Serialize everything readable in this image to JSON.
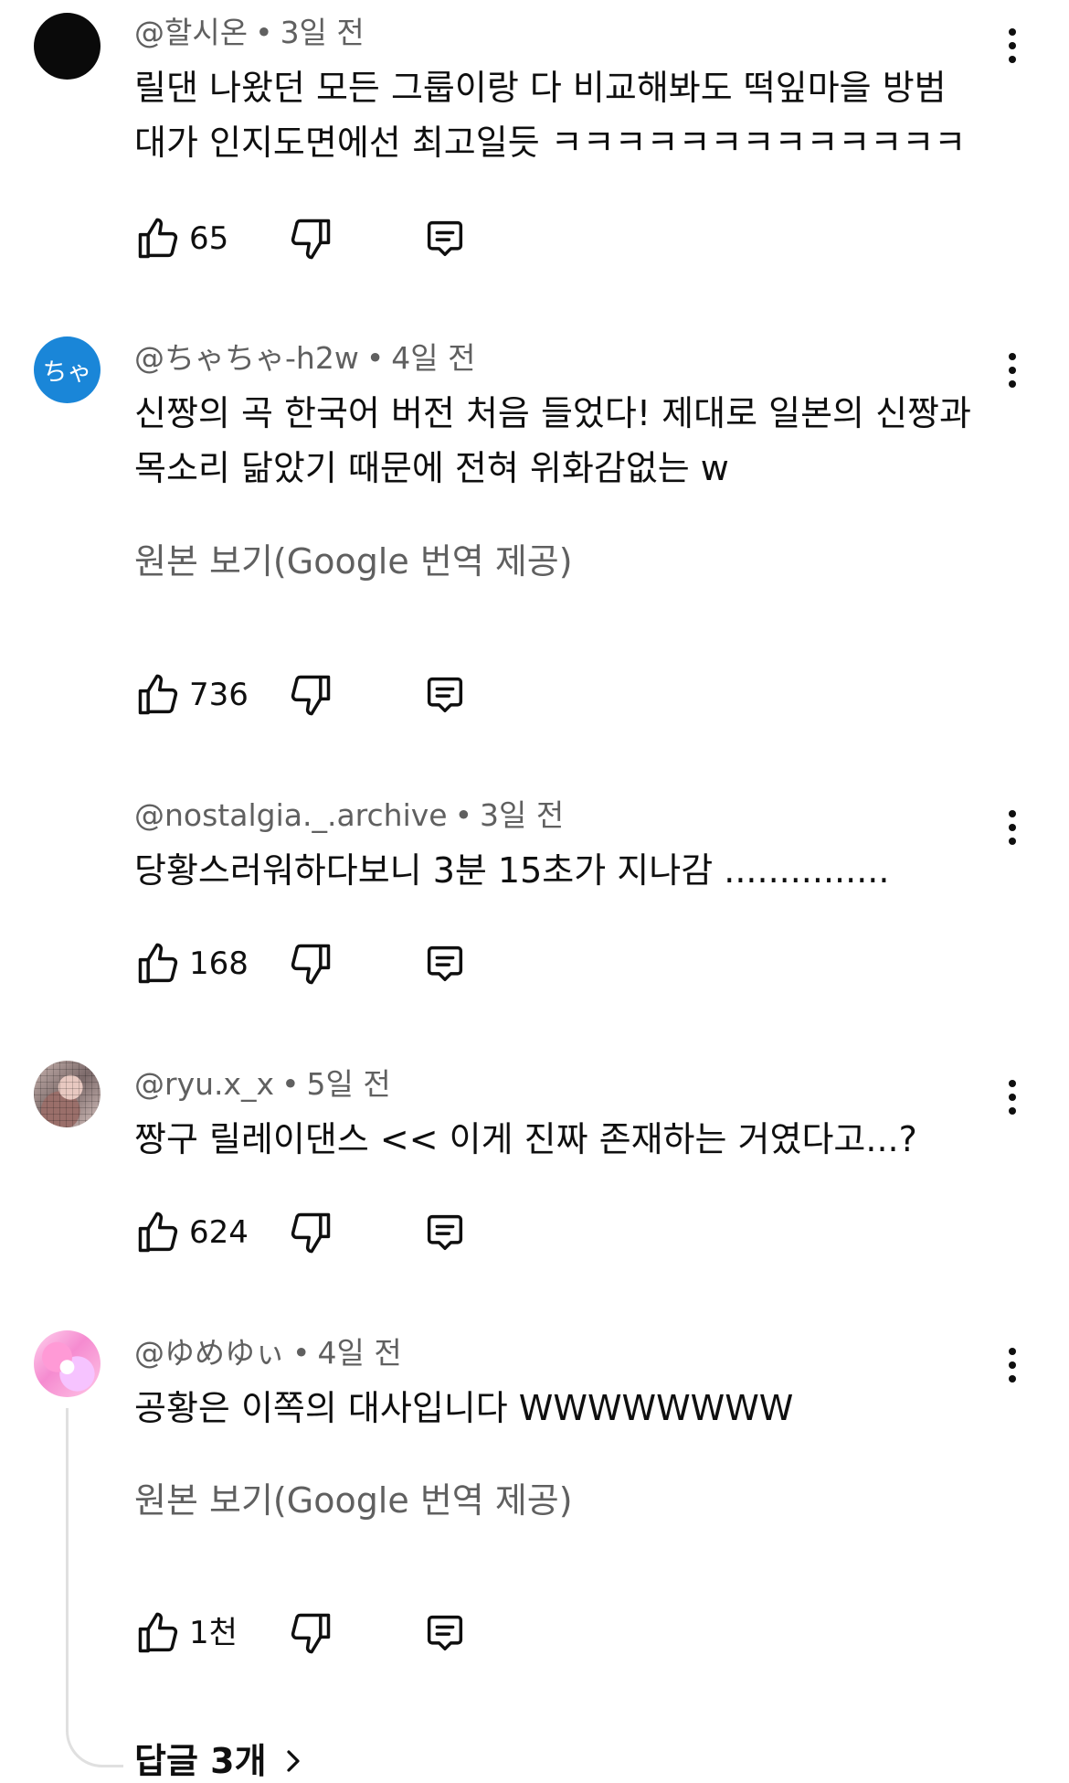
{
  "comments": [
    {
      "author": "@할시온",
      "time": "3일 전",
      "lines": [
        "릴댄 나왔던 모든 그룹이랑 다 비교해봐도 떡잎마을 방범",
        "대가 인지도면에선 최고일듯 ㅋㅋㅋㅋㅋㅋㅋㅋㅋㅋㅋㅋㅋ"
      ],
      "likes": "65",
      "avatar": "black-circle"
    },
    {
      "author": "@ちゃちゃ-h2w",
      "time": "4일 전",
      "lines": [
        "신짱의 곡 한국어 버전 처음 들었다! 제대로 일본의 신짱과",
        "목소리 닮았기 때문에 전혀 위화감없는 w"
      ],
      "translate": "원본 보기(Google 번역 제공)",
      "likes": "736",
      "avatar_text": "ちゃ"
    },
    {
      "author": "@nostalgia._.archive",
      "time": "3일 전",
      "lines": [
        "당황스러워하다보니 3분 15초가 지나감 ..............."
      ],
      "likes": "168"
    },
    {
      "author": "@ryu.x_x",
      "time": "5일 전",
      "lines": [
        "짱구 릴레이댄스 << 이게 진짜 존재하는 거였다고...?"
      ],
      "likes": "624",
      "avatar": "photo"
    },
    {
      "author": "@ゆめゆぃ",
      "time": "4일 전",
      "lines": [
        "공황은 이쪽의 대사입니다 WWWWWWWW"
      ],
      "translate": "원본 보기(Google 번역 제공)",
      "likes": "1천",
      "avatar": "pink-illustration"
    }
  ],
  "separator": "•",
  "replies_label": "답글 3개",
  "icons": {
    "like": "thumbs-up-icon",
    "dislike": "thumbs-down-icon",
    "reply": "reply-comment-icon",
    "menu": "more-vert-icon",
    "replies": "chevron-right-icon"
  },
  "colors": {
    "text": "#0f0f0f",
    "meta": "#606060",
    "avatar_blue": "#1a86d8"
  }
}
